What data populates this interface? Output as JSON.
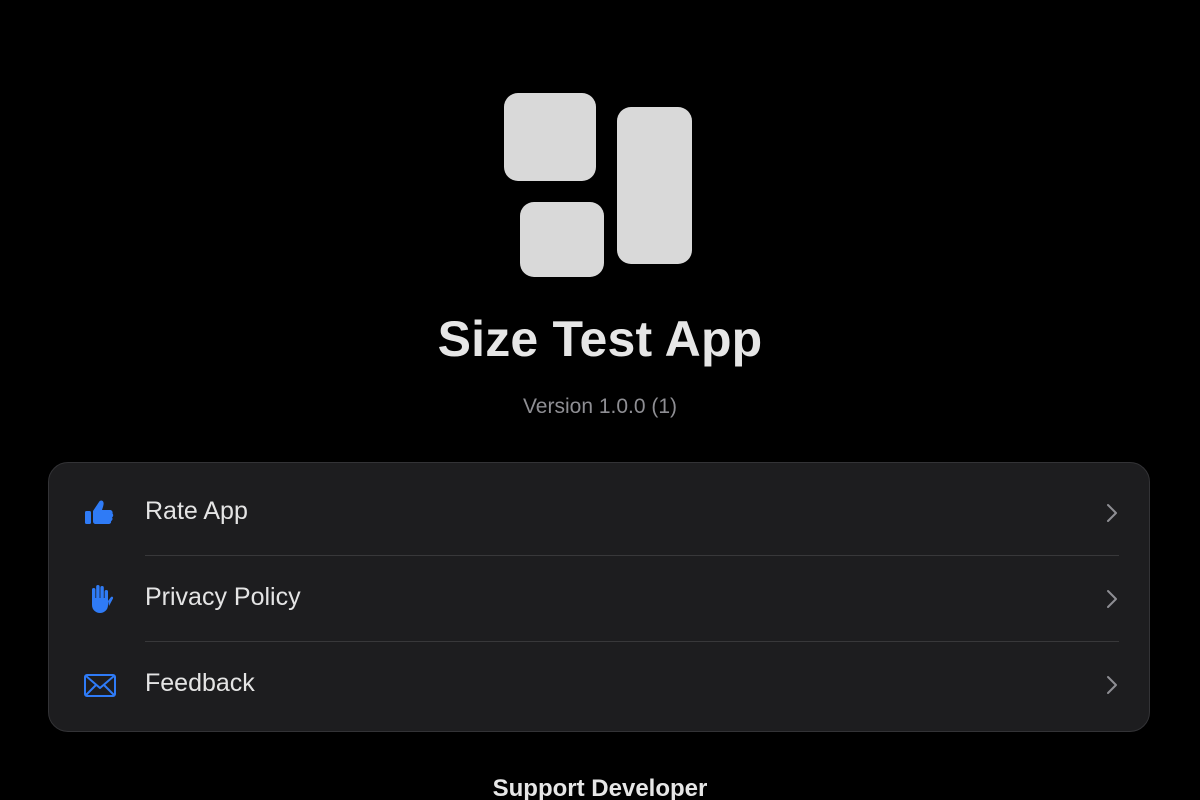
{
  "app": {
    "title": "Size Test App",
    "version": "Version 1.0.0 (1)",
    "icon": "app-logo-tiles"
  },
  "menu": {
    "items": [
      {
        "label": "Rate App",
        "icon": "thumbs-up-icon"
      },
      {
        "label": "Privacy Policy",
        "icon": "hand-raised-icon"
      },
      {
        "label": "Feedback",
        "icon": "envelope-icon"
      }
    ]
  },
  "support": {
    "heading": "Support Developer"
  },
  "colors": {
    "background": "#000000",
    "card": "#1d1d1f",
    "accent": "#2f7bf6",
    "text": "#e4e4e4",
    "secondary_text": "#8e8e93"
  }
}
